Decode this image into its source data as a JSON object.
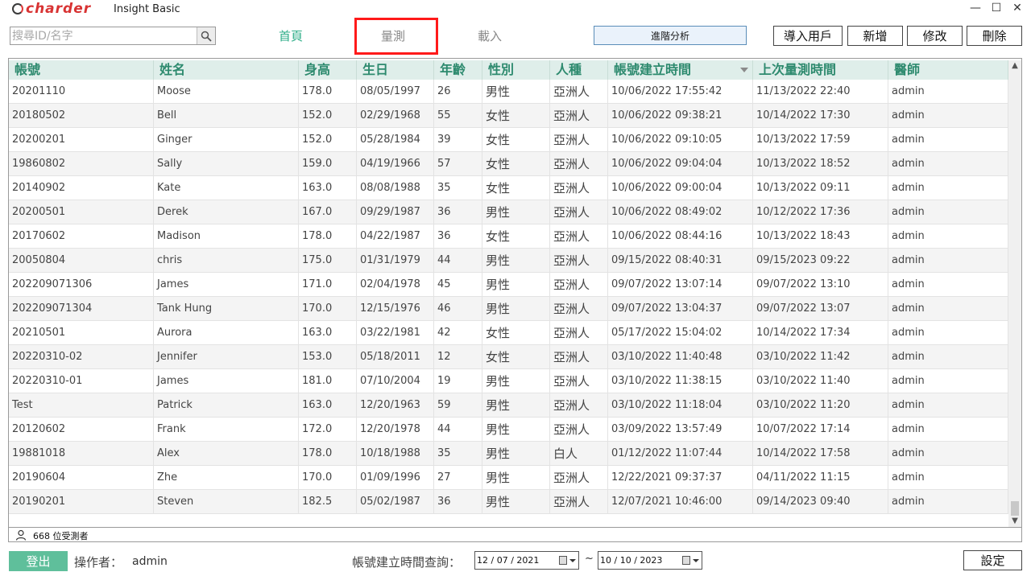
{
  "brand": {
    "logo_text": "charder",
    "app_title": "Insight Basic"
  },
  "window_controls": {
    "minimize": "—",
    "maximize": "☐",
    "close": "✕"
  },
  "search": {
    "placeholder": "搜尋ID/名字",
    "value": ""
  },
  "tabs": [
    {
      "label": "首頁"
    },
    {
      "label": "量測"
    },
    {
      "label": "載入"
    }
  ],
  "toolbar": {
    "advanced": "進階分析",
    "import": "導入用戶",
    "add": "新增",
    "edit": "修改",
    "delete": "刪除"
  },
  "table": {
    "headers": [
      "帳號",
      "姓名",
      "身高",
      "生日",
      "年齡",
      "性別",
      "人種",
      "帳號建立時間",
      "上次量測時間",
      "醫師"
    ],
    "rows": [
      [
        "20201110",
        "Moose",
        "178.0",
        "08/05/1997",
        "26",
        "男性",
        "亞洲人",
        "10/06/2022 17:55:42",
        "11/13/2022 22:40",
        "admin"
      ],
      [
        "20180502",
        "Bell",
        "152.0",
        "02/29/1968",
        "55",
        "女性",
        "亞洲人",
        "10/06/2022 09:38:21",
        "10/14/2022 17:30",
        "admin"
      ],
      [
        "20200201",
        "Ginger",
        "152.0",
        "05/28/1984",
        "39",
        "女性",
        "亞洲人",
        "10/06/2022 09:10:05",
        "10/13/2022 17:59",
        "admin"
      ],
      [
        "19860802",
        "Sally",
        "159.0",
        "04/19/1966",
        "57",
        "女性",
        "亞洲人",
        "10/06/2022 09:04:04",
        "10/13/2022 18:52",
        "admin"
      ],
      [
        "20140902",
        "Kate",
        "163.0",
        "08/08/1988",
        "35",
        "女性",
        "亞洲人",
        "10/06/2022 09:00:04",
        "10/13/2022 09:11",
        "admin"
      ],
      [
        "20200501",
        "Derek",
        "167.0",
        "09/29/1987",
        "36",
        "男性",
        "亞洲人",
        "10/06/2022 08:49:02",
        "10/12/2022 17:36",
        "admin"
      ],
      [
        "20170602",
        "Madison",
        "178.0",
        "04/22/1987",
        "36",
        "女性",
        "亞洲人",
        "10/06/2022 08:44:16",
        "10/13/2022 18:43",
        "admin"
      ],
      [
        "20050804",
        "chris",
        "175.0",
        "01/31/1979",
        "44",
        "男性",
        "亞洲人",
        "09/15/2022 08:40:31",
        "09/15/2023 09:22",
        "admin"
      ],
      [
        "202209071306",
        "James",
        "171.0",
        "02/04/1978",
        "45",
        "男性",
        "亞洲人",
        "09/07/2022 13:07:14",
        "09/07/2022 13:10",
        "admin"
      ],
      [
        "202209071304",
        "Tank Hung",
        "170.0",
        "12/15/1976",
        "46",
        "男性",
        "亞洲人",
        "09/07/2022 13:04:37",
        "09/07/2022 13:07",
        "admin"
      ],
      [
        "20210501",
        "Aurora",
        "163.0",
        "03/22/1981",
        "42",
        "女性",
        "亞洲人",
        "05/17/2022 15:04:02",
        "10/14/2022 17:34",
        "admin"
      ],
      [
        "20220310-02",
        "Jennifer",
        "153.0",
        "05/18/2011",
        "12",
        "女性",
        "亞洲人",
        "03/10/2022 11:40:48",
        "03/10/2022 11:42",
        "admin"
      ],
      [
        "20220310-01",
        "James",
        "181.0",
        "07/10/2004",
        "19",
        "男性",
        "亞洲人",
        "03/10/2022 11:38:15",
        "03/10/2022 11:40",
        "admin"
      ],
      [
        "Test",
        "Patrick",
        "163.0",
        "12/20/1963",
        "59",
        "男性",
        "亞洲人",
        "03/10/2022 11:18:04",
        "03/10/2022 11:20",
        "admin"
      ],
      [
        "20120602",
        "Frank",
        "172.0",
        "12/20/1978",
        "44",
        "男性",
        "亞洲人",
        "03/09/2022 13:57:49",
        "10/07/2022 17:14",
        "admin"
      ],
      [
        "19881018",
        "Alex",
        "178.0",
        "10/18/1988",
        "35",
        "男性",
        "白人",
        "01/12/2022 11:07:44",
        "10/14/2022 17:58",
        "admin"
      ],
      [
        "20190604",
        "Zhe",
        "170.0",
        "01/09/1996",
        "27",
        "男性",
        "亞洲人",
        "12/22/2021 09:37:37",
        "04/11/2022 11:15",
        "admin"
      ],
      [
        "20190201",
        "Steven",
        "182.5",
        "05/02/1987",
        "36",
        "男性",
        "亞洲人",
        "12/07/2021 10:46:00",
        "09/14/2023 09:40",
        "admin"
      ]
    ]
  },
  "status": {
    "count_text": "668 位受測者"
  },
  "footer": {
    "logout": "登出",
    "operator_label": "操作者：",
    "operator_value": "admin",
    "query_label": "帳號建立時間查詢：",
    "date_from": "12 / 07 / 2021",
    "date_to": "10 / 10 / 2023",
    "tilde": "~",
    "settings": "設定"
  },
  "colors": {
    "accent": "#2fae88",
    "header_bg": "#dfeeea",
    "highlight": "#ff1a1a",
    "logout_bg": "#5fbf9b"
  }
}
